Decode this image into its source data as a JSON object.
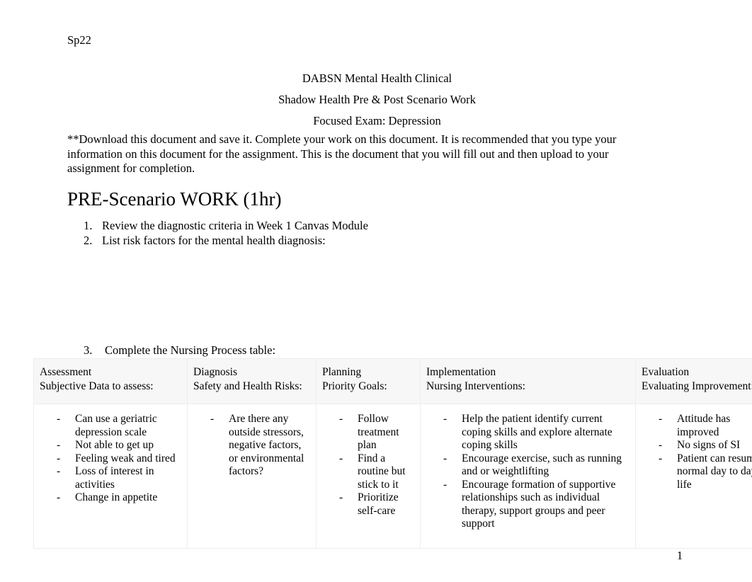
{
  "document": {
    "header_left": "Sp22",
    "page_number": "1",
    "title_lines": [
      "DABSN Mental Health Clinical",
      "Shadow Health Pre & Post Scenario Work",
      "Focused Exam: Depression"
    ],
    "instructions": "**Download this document and save it.   Complete your work on this document.   It is recommended that you type your information on this document for the assignment.    This is the document that you will fill out and then upload to your assignment for completion.",
    "section_heading": "PRE-Scenario WORK (1hr)",
    "tasks": [
      {
        "number": "1.",
        "text": "Review the diagnostic criteria in Week 1 Canvas Module"
      },
      {
        "number": "2.",
        "text": "List risk factors for the mental health diagnosis:"
      }
    ],
    "task_three": {
      "number": "3.",
      "text": "Complete the Nursing Process table:"
    }
  },
  "nursing_process_table": {
    "columns": [
      {
        "header": "Assessment",
        "subheader": "Subjective Data to assess:",
        "bullet_marker": "-",
        "items": [
          "Can use a geriatric depression scale",
          "Not able to get up",
          "Feeling weak and tired",
          "Loss of interest in activities",
          "Change in appetite"
        ]
      },
      {
        "header": "Diagnosis",
        "subheader": "Safety and Health Risks:",
        "bullet_marker": "-",
        "items": [
          "Are there any outside stressors, negative factors, or environmental factors?"
        ]
      },
      {
        "header": "Planning",
        "subheader": "Priority Goals:",
        "bullet_marker": "-",
        "items": [
          "Follow treatment plan",
          "Find a routine but stick to it",
          "Prioritize self-care"
        ]
      },
      {
        "header": "Implementation",
        "subheader": "Nursing Interventions:",
        "bullet_marker": "-",
        "items": [
          "Help the patient identify current coping skills and explore alternate coping skills",
          "Encourage exercise, such as running and or weightlifting",
          "Encourage formation of supportive relationships such as individual therapy, support groups and peer support"
        ]
      },
      {
        "header": "Evaluation",
        "subheader": "Evaluating Improvement:",
        "bullet_marker": "-",
        "items": [
          "Attitude has improved",
          "No signs of SI",
          "Patient can resume normal day to day life"
        ]
      }
    ]
  }
}
